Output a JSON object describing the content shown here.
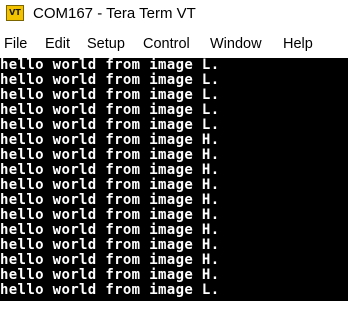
{
  "window": {
    "title": "COM167 - Tera Term VT",
    "icon_text": "VT"
  },
  "menu": {
    "items": [
      {
        "label": "File"
      },
      {
        "label": "Edit"
      },
      {
        "label": "Setup"
      },
      {
        "label": "Control"
      },
      {
        "label": "Window"
      },
      {
        "label": "Help"
      }
    ]
  },
  "terminal": {
    "foreground": "#ffffff",
    "background": "#000000",
    "lines": [
      "hello world from image L.",
      "hello world from image L.",
      "hello world from image L.",
      "hello world from image L.",
      "hello world from image L.",
      "hello world from image H.",
      "hello world from image H.",
      "hello world from image H.",
      "hello world from image H.",
      "hello world from image H.",
      "hello world from image H.",
      "hello world from image H.",
      "hello world from image H.",
      "hello world from image H.",
      "hello world from image H.",
      "hello world from image L."
    ]
  }
}
